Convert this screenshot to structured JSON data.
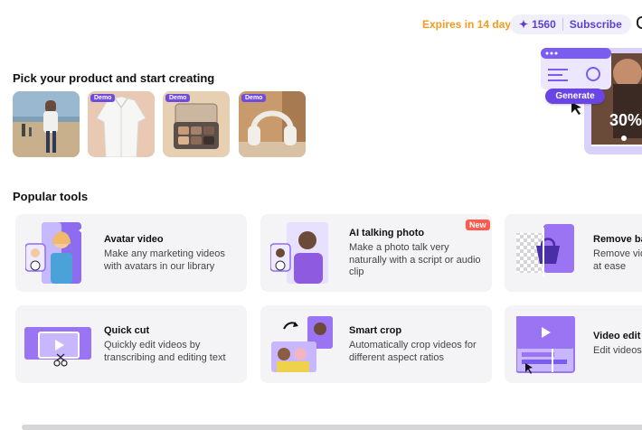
{
  "header": {
    "expires": "Expires in 14 days",
    "credits": "1560",
    "subscribe": "Subscribe"
  },
  "products": {
    "title": "Pick your product and start creating",
    "items": [
      {
        "name": "person-on-beach",
        "badge": ""
      },
      {
        "name": "white-shirt",
        "badge": "Demo"
      },
      {
        "name": "eyeshadow-palette",
        "badge": "Demo"
      },
      {
        "name": "headphones",
        "badge": "Demo"
      }
    ]
  },
  "hero": {
    "generate_label": "Generate",
    "percent": "30%"
  },
  "tools": {
    "title": "Popular tools",
    "items": [
      {
        "title": "Avatar video",
        "desc": "Make any marketing videos with avatars in our library",
        "badge": ""
      },
      {
        "title": "AI talking photo",
        "desc": "Make a photo talk very naturally with a script or audio clip",
        "badge": "New"
      },
      {
        "title": "Remove ba",
        "desc": "Remove vid at ease",
        "badge": ""
      },
      {
        "title": "Quick cut",
        "desc": "Quickly edit videos by transcribing and editing text",
        "badge": ""
      },
      {
        "title": "Smart crop",
        "desc": "Automatically crop videos for different aspect ratios",
        "badge": ""
      },
      {
        "title": "Video edit",
        "desc": "Edit videos",
        "badge": ""
      }
    ]
  },
  "colors": {
    "accent": "#6f4ce0",
    "expires": "#f39a1f",
    "new_badge": "#ff5a4e"
  }
}
